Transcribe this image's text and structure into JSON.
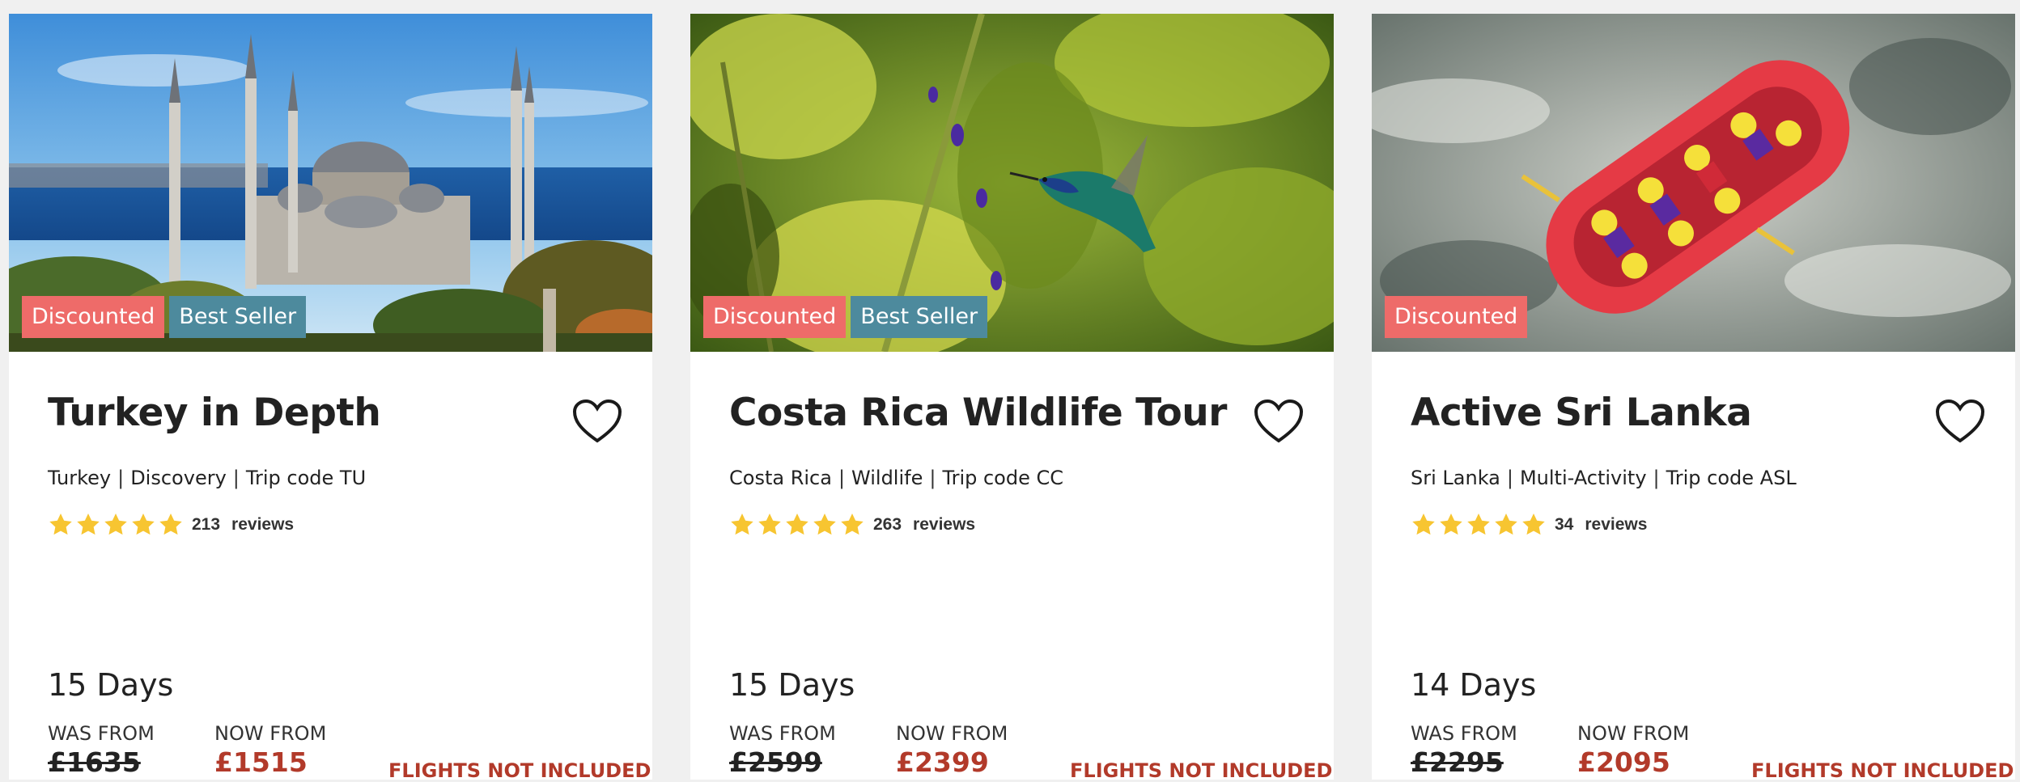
{
  "colors": {
    "page_bg": "#f0f0f0",
    "card_bg": "#ffffff",
    "badge_discounted": "#ee6b69",
    "badge_best_seller": "#4d8a9d",
    "price_now": "#b23a2a",
    "flights_note": "#b23a2a",
    "star": "#f7c531"
  },
  "tours": [
    {
      "image": "istanbul-blue-mosque-photo",
      "badges": {
        "discounted": "Discounted",
        "best_seller": "Best Seller"
      },
      "title": "Turkey in Depth",
      "country": "Turkey",
      "style": "Discovery",
      "trip_code": "Trip code TU",
      "rating_stars": 5,
      "review_count": "213",
      "reviews_word": "reviews",
      "duration": "15 Days",
      "was_label": "WAS FROM",
      "was_price": "£1635",
      "now_label": "NOW FROM",
      "now_price": "£1515",
      "flights_note": "FLIGHTS NOT INCLUDED",
      "favorite_icon": "heart-outline-icon"
    },
    {
      "image": "hummingbird-in-foliage-photo",
      "badges": {
        "discounted": "Discounted",
        "best_seller": "Best Seller"
      },
      "title": "Costa Rica Wildlife Tour",
      "country": "Costa Rica",
      "style": "Wildlife",
      "trip_code": "Trip code CC",
      "rating_stars": 5,
      "review_count": "263",
      "reviews_word": "reviews",
      "duration": "15 Days",
      "was_label": "WAS FROM",
      "was_price": "£2599",
      "now_label": "NOW FROM",
      "now_price": "£2399",
      "flights_note": "FLIGHTS NOT INCLUDED",
      "favorite_icon": "heart-outline-icon"
    },
    {
      "image": "white-water-rafting-photo",
      "badges": {
        "discounted": "Discounted"
      },
      "title": "Active Sri Lanka",
      "country": "Sri Lanka",
      "style": "Multi-Activity",
      "trip_code": "Trip code ASL",
      "rating_stars": 5,
      "review_count": "34",
      "reviews_word": "reviews",
      "duration": "14 Days",
      "was_label": "WAS FROM",
      "was_price": "£2295",
      "now_label": "NOW FROM",
      "now_price": "£2095",
      "flights_note": "FLIGHTS NOT INCLUDED",
      "favorite_icon": "heart-outline-icon"
    }
  ]
}
